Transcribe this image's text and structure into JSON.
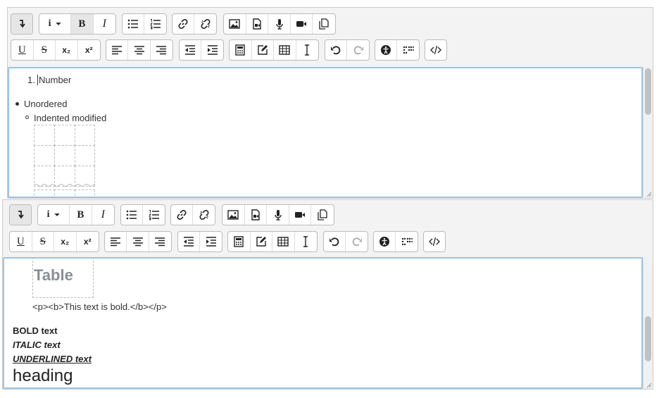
{
  "editor1": {
    "ordered_list_number": "1.",
    "ordered_item": "Number",
    "unordered_item": "Unordered",
    "indented_item": "Indented modified"
  },
  "editor2": {
    "table_heading": "Table",
    "code_text": "<p><b>This text is bold.</b></p>",
    "bold_text": "BOLD text",
    "italic_text": "ITALIC text",
    "underlined_text": "UNDERLINED text",
    "heading_text": "heading"
  },
  "toolbar": {
    "bold_label": "B",
    "italic_label": "I",
    "underline_label": "U",
    "strike_label": "S",
    "subscript_label": "x₂",
    "superscript_label": "x²",
    "info_label": "i"
  },
  "colors": {
    "focus_border": "#9ec3e6",
    "toolbar_bg": "#f3f3f3"
  }
}
